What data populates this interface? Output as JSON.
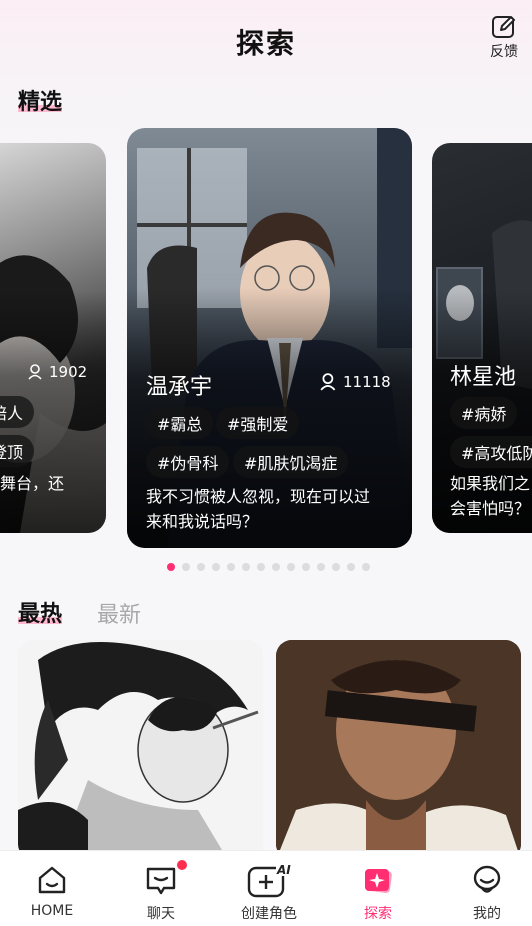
{
  "header": {
    "title": "探索",
    "feedback_label": "反馈"
  },
  "featured": {
    "section_title": "精选",
    "cards": [
      {
        "name": "",
        "count": "1902",
        "tags": [
          "陪人",
          "登顶"
        ],
        "desc": "舞台，还"
      },
      {
        "name": "温承宇",
        "count": "11118",
        "tags": [
          "#霸总",
          "#强制爱",
          "#伪骨科",
          "#肌肤饥渴症"
        ],
        "desc_line1": "我不习惯被人忽视，现在可以过",
        "desc_line2": "来和我说话吗？"
      },
      {
        "name": "林星池",
        "count": "",
        "tags": [
          "#病娇",
          "#高攻低防"
        ],
        "desc_line1": "如果我们之",
        "desc_line2": "会害怕吗？"
      }
    ],
    "pagination": {
      "total": 14,
      "active_index": 0
    }
  },
  "feed": {
    "tab_hot": "最热",
    "tab_new": "最新",
    "active_tab": "最热"
  },
  "bottom_nav": {
    "items": [
      {
        "label": "HOME",
        "icon": "home-icon"
      },
      {
        "label": "聊天",
        "icon": "chat-icon"
      },
      {
        "label": "创建角色",
        "icon": "create-ai-icon"
      },
      {
        "label": "探索",
        "icon": "explore-icon"
      },
      {
        "label": "我的",
        "icon": "profile-icon"
      }
    ],
    "active": "探索",
    "ai_badge": "AI"
  },
  "colors": {
    "accent": "#ff2d72",
    "highlight": "#ffb8cf"
  }
}
